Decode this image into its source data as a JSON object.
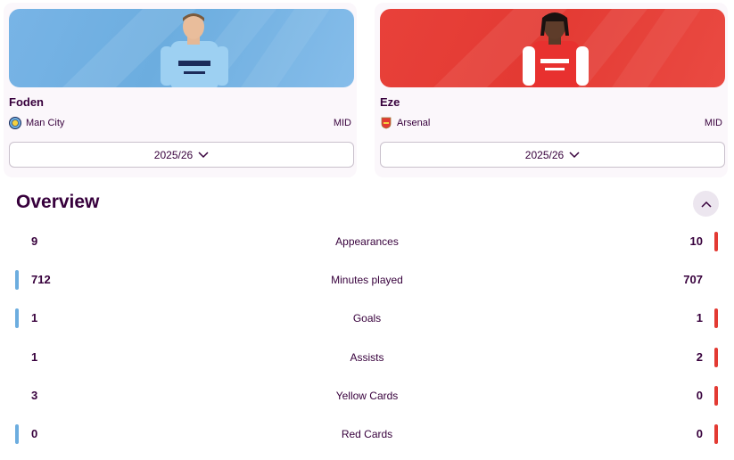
{
  "players": {
    "left": {
      "name": "Foden",
      "club": "Man City",
      "position": "MID",
      "season": "2025/26",
      "color": "#6caddf"
    },
    "right": {
      "name": "Eze",
      "club": "Arsenal",
      "position": "MID",
      "season": "2025/26",
      "color": "#e33a33"
    }
  },
  "overview": {
    "title": "Overview",
    "stats": [
      {
        "label": "Appearances",
        "left": "9",
        "right": "10",
        "leader": "right"
      },
      {
        "label": "Minutes played",
        "left": "712",
        "right": "707",
        "leader": "left"
      },
      {
        "label": "Goals",
        "left": "1",
        "right": "1",
        "leader": "both"
      },
      {
        "label": "Assists",
        "left": "1",
        "right": "2",
        "leader": "right"
      },
      {
        "label": "Yellow Cards",
        "left": "3",
        "right": "0",
        "leader": "right"
      },
      {
        "label": "Red Cards",
        "left": "0",
        "right": "0",
        "leader": "both"
      }
    ]
  }
}
